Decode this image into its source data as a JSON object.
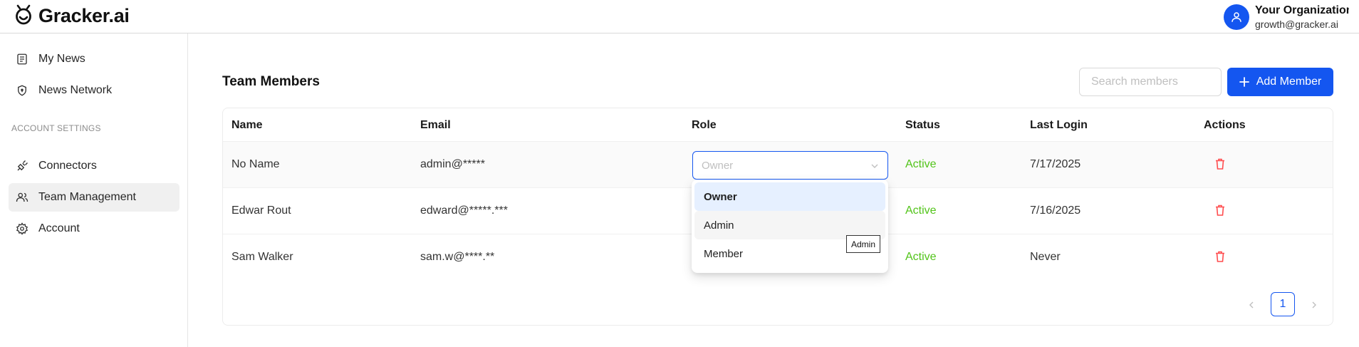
{
  "header": {
    "brand": "Gracker.ai",
    "org_name": "Your Organization",
    "org_email": "growth@gracker.ai"
  },
  "sidebar": {
    "items": [
      {
        "label": "My News",
        "icon": "news-icon"
      },
      {
        "label": "News Network",
        "icon": "shield-icon"
      }
    ],
    "section_label": "ACCOUNT SETTINGS",
    "settings_items": [
      {
        "label": "Connectors",
        "icon": "plug-icon"
      },
      {
        "label": "Team Management",
        "icon": "users-icon",
        "active": true
      },
      {
        "label": "Account",
        "icon": "gear-icon"
      }
    ]
  },
  "main": {
    "title": "Team Members",
    "search_placeholder": "Search members",
    "add_button": "Add Member",
    "columns": [
      "Name",
      "Email",
      "Role",
      "Status",
      "Last Login",
      "Actions"
    ],
    "rows": [
      {
        "name": "No Name",
        "email": "admin@*****",
        "role": "Owner",
        "status": "Active",
        "last_login": "7/17/2025"
      },
      {
        "name": "Edwar Rout",
        "email": "edward@*****.***",
        "role": "",
        "status": "Active",
        "last_login": "7/16/2025"
      },
      {
        "name": "Sam Walker",
        "email": "sam.w@****.**",
        "role": "",
        "status": "Active",
        "last_login": "Never"
      }
    ],
    "pagination": {
      "current": "1"
    }
  },
  "dropdown": {
    "options": [
      "Owner",
      "Admin",
      "Member"
    ],
    "selected": "Owner",
    "hovered": "Admin",
    "tooltip": "Admin"
  },
  "colors": {
    "primary": "#1456f0",
    "status_active": "#52c41a",
    "delete": "#ff4d4f"
  }
}
